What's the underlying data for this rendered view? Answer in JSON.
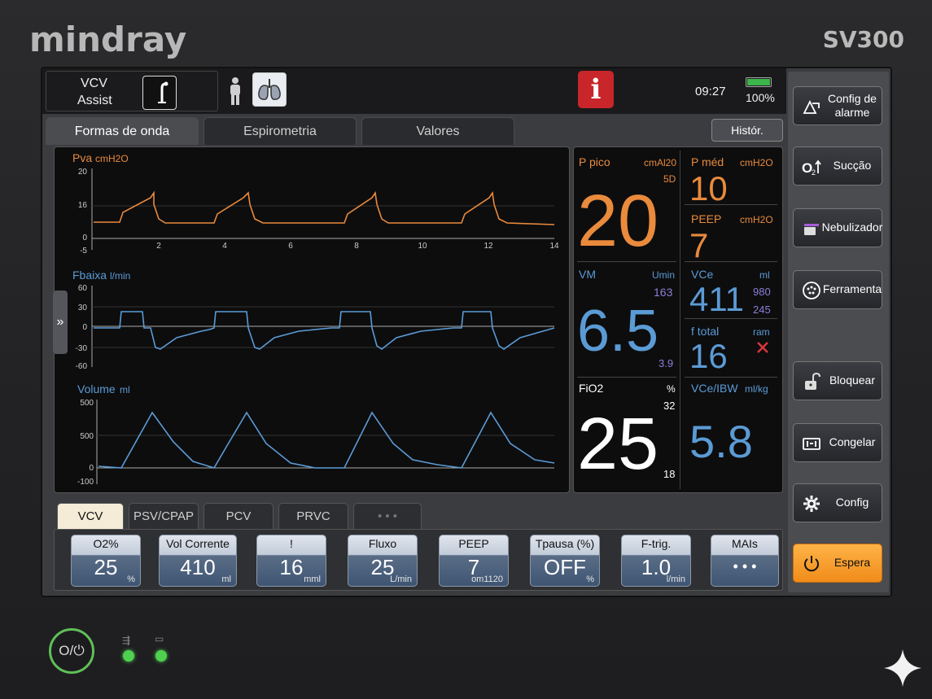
{
  "device": {
    "brand": "mindray",
    "model": "SV300"
  },
  "status": {
    "mode_line1": "VCV",
    "mode_line2": "Assist",
    "time": "09:27",
    "battery_percent": "100%",
    "battery_level": 1.0,
    "alarm_info_glyph": "i"
  },
  "tabs": [
    {
      "label": "Formas de onda",
      "active": true
    },
    {
      "label": "Espirometria",
      "active": false
    },
    {
      "label": "Valores",
      "active": false
    }
  ],
  "history_button": "Histór.",
  "expand_glyph": "»",
  "waveforms": {
    "pressure": {
      "title": "Pva",
      "unit": "cmH2O",
      "y_ticks": [
        "20",
        "16",
        "0",
        "-5"
      ],
      "x_ticks": [
        "2",
        "4",
        "6",
        "8",
        "10",
        "12",
        "14"
      ],
      "color": "#e98a3c"
    },
    "flow": {
      "title": "Fbaixa",
      "unit": "l/min",
      "y_ticks": [
        "60",
        "30",
        "0",
        "-30",
        "-60"
      ],
      "color": "#5b9bd5"
    },
    "volume": {
      "title": "Volume",
      "unit": "ml",
      "y_ticks": [
        "500",
        "500",
        "0",
        "-100"
      ],
      "color": "#5b9bd5"
    }
  },
  "numerics": {
    "ppico": {
      "label": "P pico",
      "unit": "cmAl20",
      "sub": "5D",
      "value": "20"
    },
    "pmed": {
      "label": "P méd",
      "unit": "cmH2O",
      "value": "10"
    },
    "peep": {
      "label": "PEEP",
      "unit": "cmH2O",
      "value": "7"
    },
    "vm": {
      "label": "VM",
      "unit": "Umin",
      "upper": "163",
      "lower": "3.9",
      "value": "6.5"
    },
    "vce": {
      "label": "VCe",
      "unit": "ml",
      "upper": "980",
      "lower": "245",
      "value": "411"
    },
    "ftotal": {
      "label": "f total",
      "unit": "ram",
      "value": "16"
    },
    "fio2": {
      "label": "FiO2",
      "unit": "%",
      "upper": "32",
      "lower": "18",
      "value": "25"
    },
    "vce_ibw": {
      "label": "VCe/IBW",
      "unit": "ml/kg",
      "value": "5.8"
    }
  },
  "mode_tabs": [
    {
      "label": "VCV",
      "active": true
    },
    {
      "label": "PSV/CPAP",
      "active": false
    },
    {
      "label": "PCV",
      "active": false
    },
    {
      "label": "PRVC",
      "active": false
    },
    {
      "label": "• • •",
      "active": false
    }
  ],
  "params": [
    {
      "label": "O2%",
      "value": "25",
      "unit": "%"
    },
    {
      "label": "Vol Corrente",
      "value": "410",
      "unit": "ml"
    },
    {
      "label": "!",
      "value": "16",
      "unit": "mml"
    },
    {
      "label": "Fluxo",
      "value": "25",
      "unit": "L/min"
    },
    {
      "label": "PEEP",
      "value": "7",
      "unit": "om1120"
    },
    {
      "label": "Tpausa (%)",
      "value": "OFF",
      "unit": "%"
    },
    {
      "label": "F-trig.",
      "value": "1.0",
      "unit": "l/min"
    },
    {
      "label": "MAIs",
      "value": "• • •",
      "unit": ""
    }
  ],
  "side_buttons": [
    {
      "label": "Config de alarme",
      "icon": "alarm-config-icon"
    },
    {
      "label": "Sucção",
      "icon": "o2-suction-icon"
    },
    {
      "label": "Nebulizador",
      "icon": "nebulizer-icon"
    },
    {
      "label": "Ferramenta",
      "icon": "tools-icon"
    },
    {
      "label": "Bloquear",
      "icon": "lock-icon"
    },
    {
      "label": "Congelar",
      "icon": "freeze-icon"
    },
    {
      "label": "Config",
      "icon": "gear-icon"
    },
    {
      "label": "Espera",
      "icon": "power-icon"
    }
  ],
  "front_panel": {
    "power_label": "O/⏻"
  }
}
